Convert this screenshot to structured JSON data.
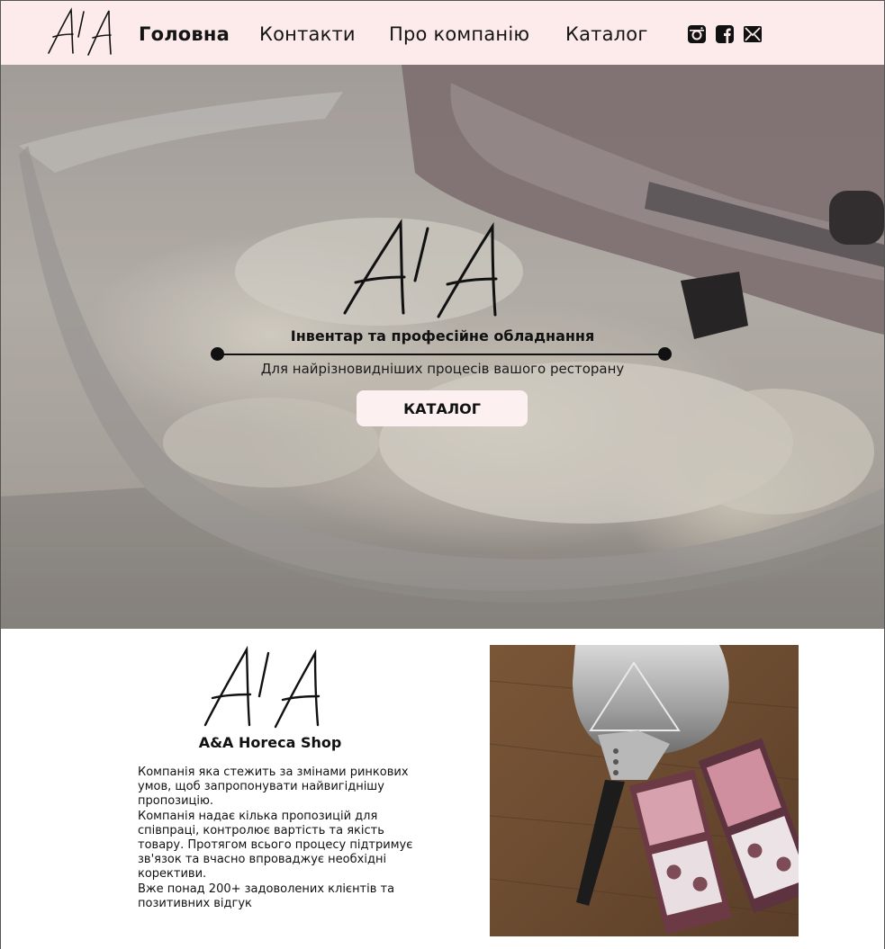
{
  "nav": {
    "logo": "A/A",
    "links": [
      {
        "label": "Головна",
        "active": true
      },
      {
        "label": "Контакти",
        "active": false
      },
      {
        "label": "Про компанію",
        "active": false
      },
      {
        "label": "Каталог",
        "active": false
      }
    ],
    "social": [
      "instagram-icon",
      "facebook-icon",
      "mail-icon"
    ]
  },
  "hero": {
    "logo": "A/A",
    "title": "Інвентар та професійне обладнання",
    "subtitle": "Для найрізновидніших процесів вашого ресторану",
    "button": "КАТАЛОГ"
  },
  "about": {
    "logo": "A/A",
    "title": "A&A Horeca Shop",
    "paragraphs": [
      "Компанія яка стежить за змінами ринкових умов, щоб запропонувати найвигіднішу пропозицію.",
      "Компанія надає кілька пропозицій для співпраці, контролює вартість та якість товару. Протягом всього процесу підтримує зв'язок та вчасно впроваджує необхідні корективи.",
      "Вже понад 200+ задоволених клієнтів та позитивних відгук"
    ]
  },
  "colors": {
    "nav_bg": "#fdebeb",
    "button_bg": "#fdf0f0",
    "text": "#111111"
  }
}
